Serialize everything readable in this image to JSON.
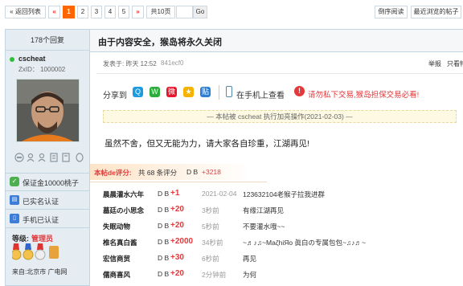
{
  "topbar": {
    "back_label": "« 返回列表",
    "prev_arrow": "«",
    "pages": [
      "1",
      "2",
      "3",
      "4",
      "5"
    ],
    "next_arrow": "»",
    "total_pages": "共10页",
    "go_label": "Go",
    "reverse_label": "倒序阅读",
    "recent_label": "最近浏览的帖子"
  },
  "sidebar": {
    "reply_count": "178个回复",
    "username": "cscheat",
    "zxid": "ZxID： 1000002",
    "guarantee": "保证金10000桃子",
    "real_name": "已实名认证",
    "phone": "手机已认证",
    "level_label": "等级:",
    "level_value": "管理员",
    "location": "来自:北京市 广电网"
  },
  "post": {
    "title": "由于内容安全，猴岛将永久关闭",
    "meta": "发表于: 昨天 12:52",
    "post_id": "841ecf0",
    "report": "举报",
    "only_view": "只看特",
    "share_label": "分享到",
    "mobile_view": "在手机上查看",
    "warning": "请勿私下交易,猴岛担保交易必看!",
    "notice": "— 本帖被 cscheat 执行加亮操作(2021-02-03) —",
    "content": "虽然不舍，但又无能为力，请大家各自珍重，江湖再见!"
  },
  "rating": {
    "header_label": "本帖de评分:",
    "header_count": "共 68 条评分",
    "header_db": "D B",
    "header_total": "+3218",
    "rows": [
      {
        "user": "晨晨灌水六年",
        "db": "D B",
        "score": "+1",
        "time": "2021-02-04",
        "reason": "123632104老猴子拉我进群"
      },
      {
        "user": "墓廷の小思念",
        "db": "D B",
        "score": "+20",
        "time": "3秒前",
        "reason": "有缘江湖再见"
      },
      {
        "user": "失眠动物",
        "db": "D B",
        "score": "+20",
        "time": "5秒前",
        "reason": "不要灌水哦~~"
      },
      {
        "user": "椎名真白酱",
        "db": "D B",
        "score": "+2000",
        "time": "34秒前",
        "reason": "~♬♪♫~MaζhiЯo 眞白の专属包包~♫♪♬~"
      },
      {
        "user": "宏信商贸",
        "db": "D B",
        "score": "+30",
        "time": "6秒前",
        "reason": "再见"
      },
      {
        "user": "儒商喜风",
        "db": "D B",
        "score": "+20",
        "time": "2分钟前",
        "reason": "为何"
      }
    ]
  },
  "colors": {
    "accent": "#ff6600",
    "score_red": "#e4393c",
    "link_blue": "#336699"
  }
}
